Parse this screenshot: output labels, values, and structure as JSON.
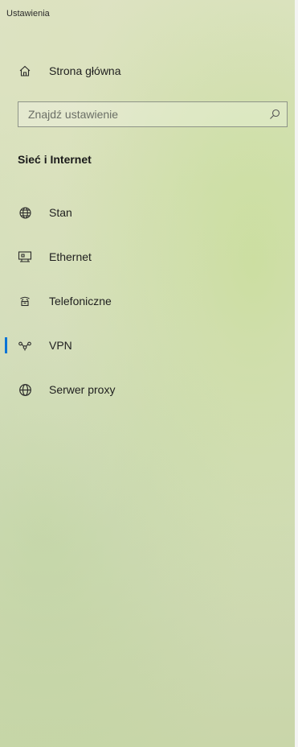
{
  "window": {
    "title": "Ustawienia"
  },
  "nav": {
    "home_label": "Strona główna",
    "home_icon": "home-icon"
  },
  "search": {
    "placeholder": "Znajdź ustawienie",
    "value": "",
    "icon": "search-icon"
  },
  "section": {
    "title": "Sieć i Internet"
  },
  "menu": {
    "selected": "VPN",
    "accent_color": "#0a74d6",
    "items": [
      {
        "label": "Stan",
        "icon": "globe-status-icon"
      },
      {
        "label": "Ethernet",
        "icon": "ethernet-icon"
      },
      {
        "label": "Telefoniczne",
        "icon": "dialup-icon"
      },
      {
        "label": "VPN",
        "icon": "vpn-icon"
      },
      {
        "label": "Serwer proxy",
        "icon": "globe-icon"
      }
    ]
  }
}
